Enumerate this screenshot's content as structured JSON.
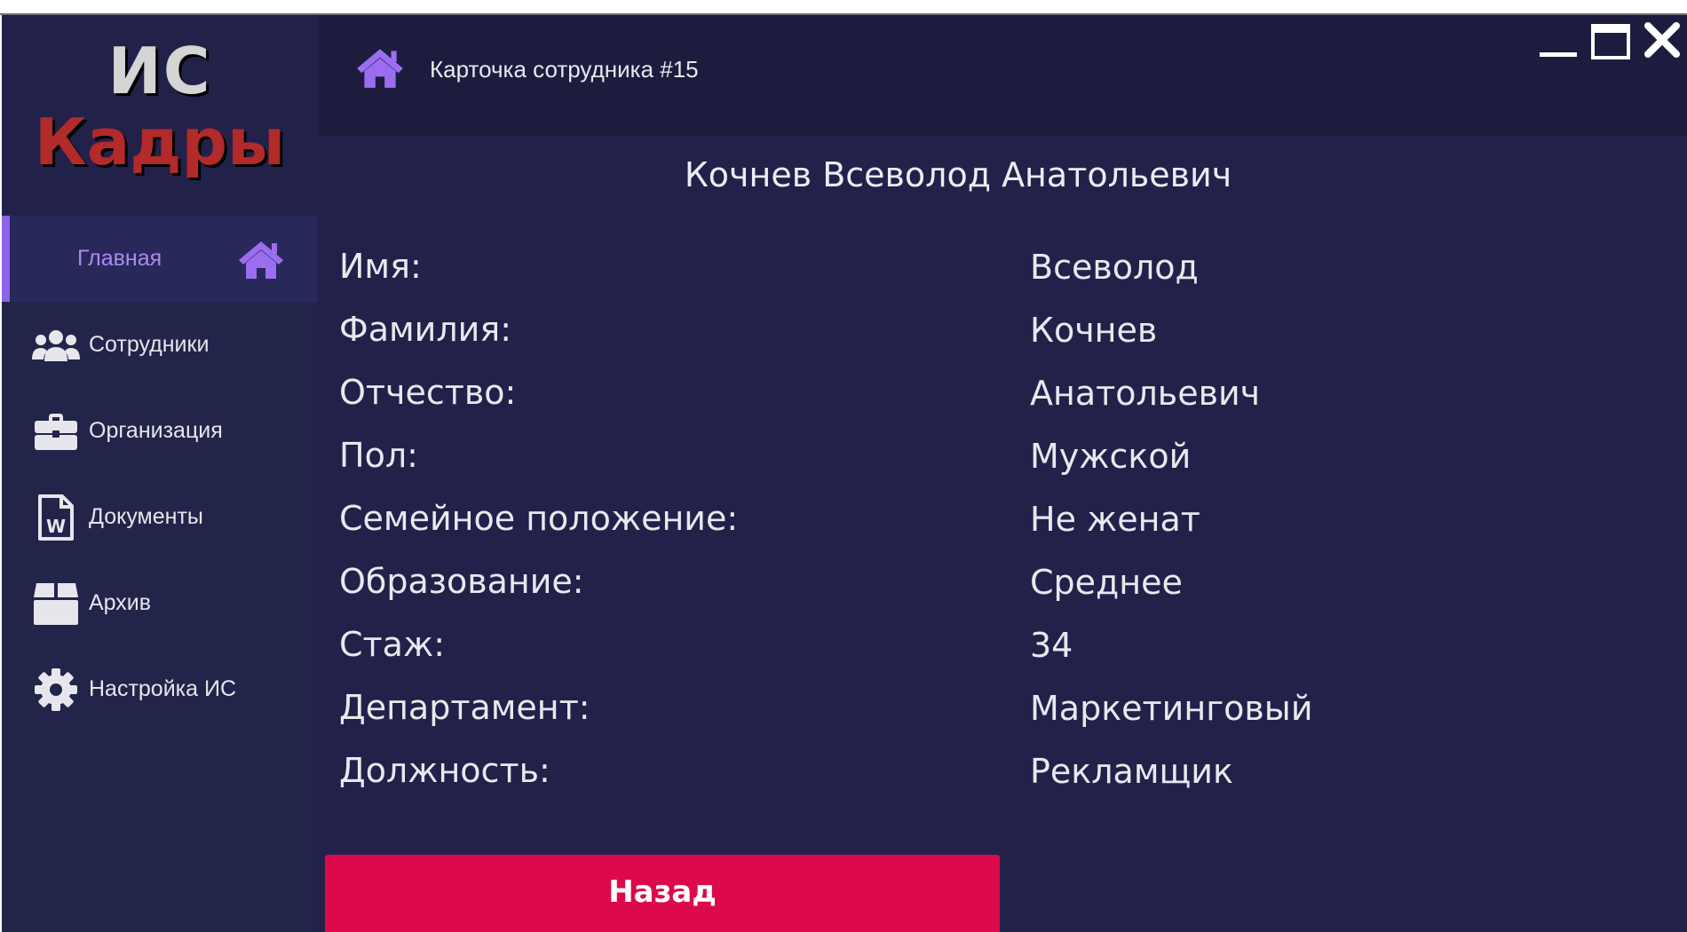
{
  "logo": {
    "line1": "ИС",
    "line2": "Кадры"
  },
  "header": {
    "title": "Карточка сотрудника #15"
  },
  "sidebar": {
    "items": [
      {
        "label": "Главная",
        "icon": "home-icon",
        "active": true
      },
      {
        "label": "Сотрудники",
        "icon": "users-icon"
      },
      {
        "label": "Организация",
        "icon": "briefcase-icon"
      },
      {
        "label": "Документы",
        "icon": "word-document-icon"
      },
      {
        "label": "Архив",
        "icon": "archive-box-icon"
      },
      {
        "label": "Настройка ИС",
        "icon": "gear-icon"
      }
    ]
  },
  "employee": {
    "full_name": "Кочнев Всеволод Анатольевич",
    "fields": [
      {
        "label": "Имя:",
        "value": "Всеволод"
      },
      {
        "label": "Фамилия:",
        "value": "Кочнев"
      },
      {
        "label": "Отчество:",
        "value": "Анатольевич"
      },
      {
        "label": "Пол:",
        "value": "Мужской"
      },
      {
        "label": "Семейное положение:",
        "value": "Не женат"
      },
      {
        "label": "Образование:",
        "value": "Среднее"
      },
      {
        "label": "Стаж:",
        "value": "34"
      },
      {
        "label": "Департамент:",
        "value": "Маркетинговый"
      },
      {
        "label": "Должность:",
        "value": "Рекламщик"
      }
    ]
  },
  "actions": {
    "back_label": "Назад"
  },
  "colors": {
    "background": "#22214a",
    "sidebar": "#23244a",
    "header": "#1d1c3f",
    "accent": "#8e62ea",
    "logo_red": "#b22a2a",
    "back_button": "#dc0a4a"
  }
}
